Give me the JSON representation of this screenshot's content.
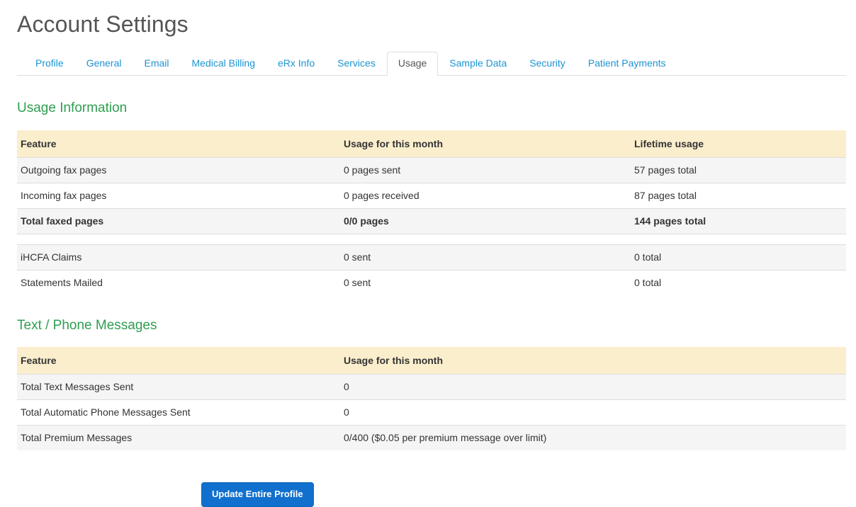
{
  "header": {
    "title": "Account Settings"
  },
  "tabs": [
    {
      "label": "Profile",
      "active": false
    },
    {
      "label": "General",
      "active": false
    },
    {
      "label": "Email",
      "active": false
    },
    {
      "label": "Medical Billing",
      "active": false
    },
    {
      "label": "eRx Info",
      "active": false
    },
    {
      "label": "Services",
      "active": false
    },
    {
      "label": "Usage",
      "active": true
    },
    {
      "label": "Sample Data",
      "active": false
    },
    {
      "label": "Security",
      "active": false
    },
    {
      "label": "Patient Payments",
      "active": false
    }
  ],
  "usage_section": {
    "heading": "Usage Information",
    "columns": [
      "Feature",
      "Usage for this month",
      "Lifetime usage"
    ],
    "rows": [
      {
        "feature": "Outgoing fax pages",
        "month": "0 pages sent",
        "lifetime": "57 pages total",
        "bold": false,
        "spacer": false
      },
      {
        "feature": "Incoming fax pages",
        "month": "0 pages received",
        "lifetime": "87 pages total",
        "bold": false,
        "spacer": false
      },
      {
        "feature": "Total faxed pages",
        "month": "0/0 pages",
        "lifetime": "144 pages total",
        "bold": true,
        "spacer": false
      },
      {
        "feature": "",
        "month": "",
        "lifetime": "",
        "bold": false,
        "spacer": true
      },
      {
        "feature": "iHCFA Claims",
        "month": "0 sent",
        "lifetime": "0 total",
        "bold": false,
        "spacer": false
      },
      {
        "feature": "Statements Mailed",
        "month": "0 sent",
        "lifetime": "0 total",
        "bold": false,
        "spacer": false
      }
    ]
  },
  "messages_section": {
    "heading": "Text / Phone Messages",
    "columns": [
      "Feature",
      "Usage for this month"
    ],
    "rows": [
      {
        "feature": "Total Text Messages Sent",
        "month": "0"
      },
      {
        "feature": "Total Automatic Phone Messages Sent",
        "month": "0"
      },
      {
        "feature": "Total Premium Messages",
        "month": "0/400 ($0.05 per premium message over limit)"
      }
    ]
  },
  "footer": {
    "update_label": "Update Entire Profile"
  },
  "colors": {
    "link": "#1c94d2",
    "heading_green": "#2e9e4f",
    "table_header_bg": "#fbeecd",
    "row_stripe": "#f5f5f5",
    "button_blue": "#1170cd",
    "border": "#dddddd",
    "title_gray": "#555555"
  }
}
